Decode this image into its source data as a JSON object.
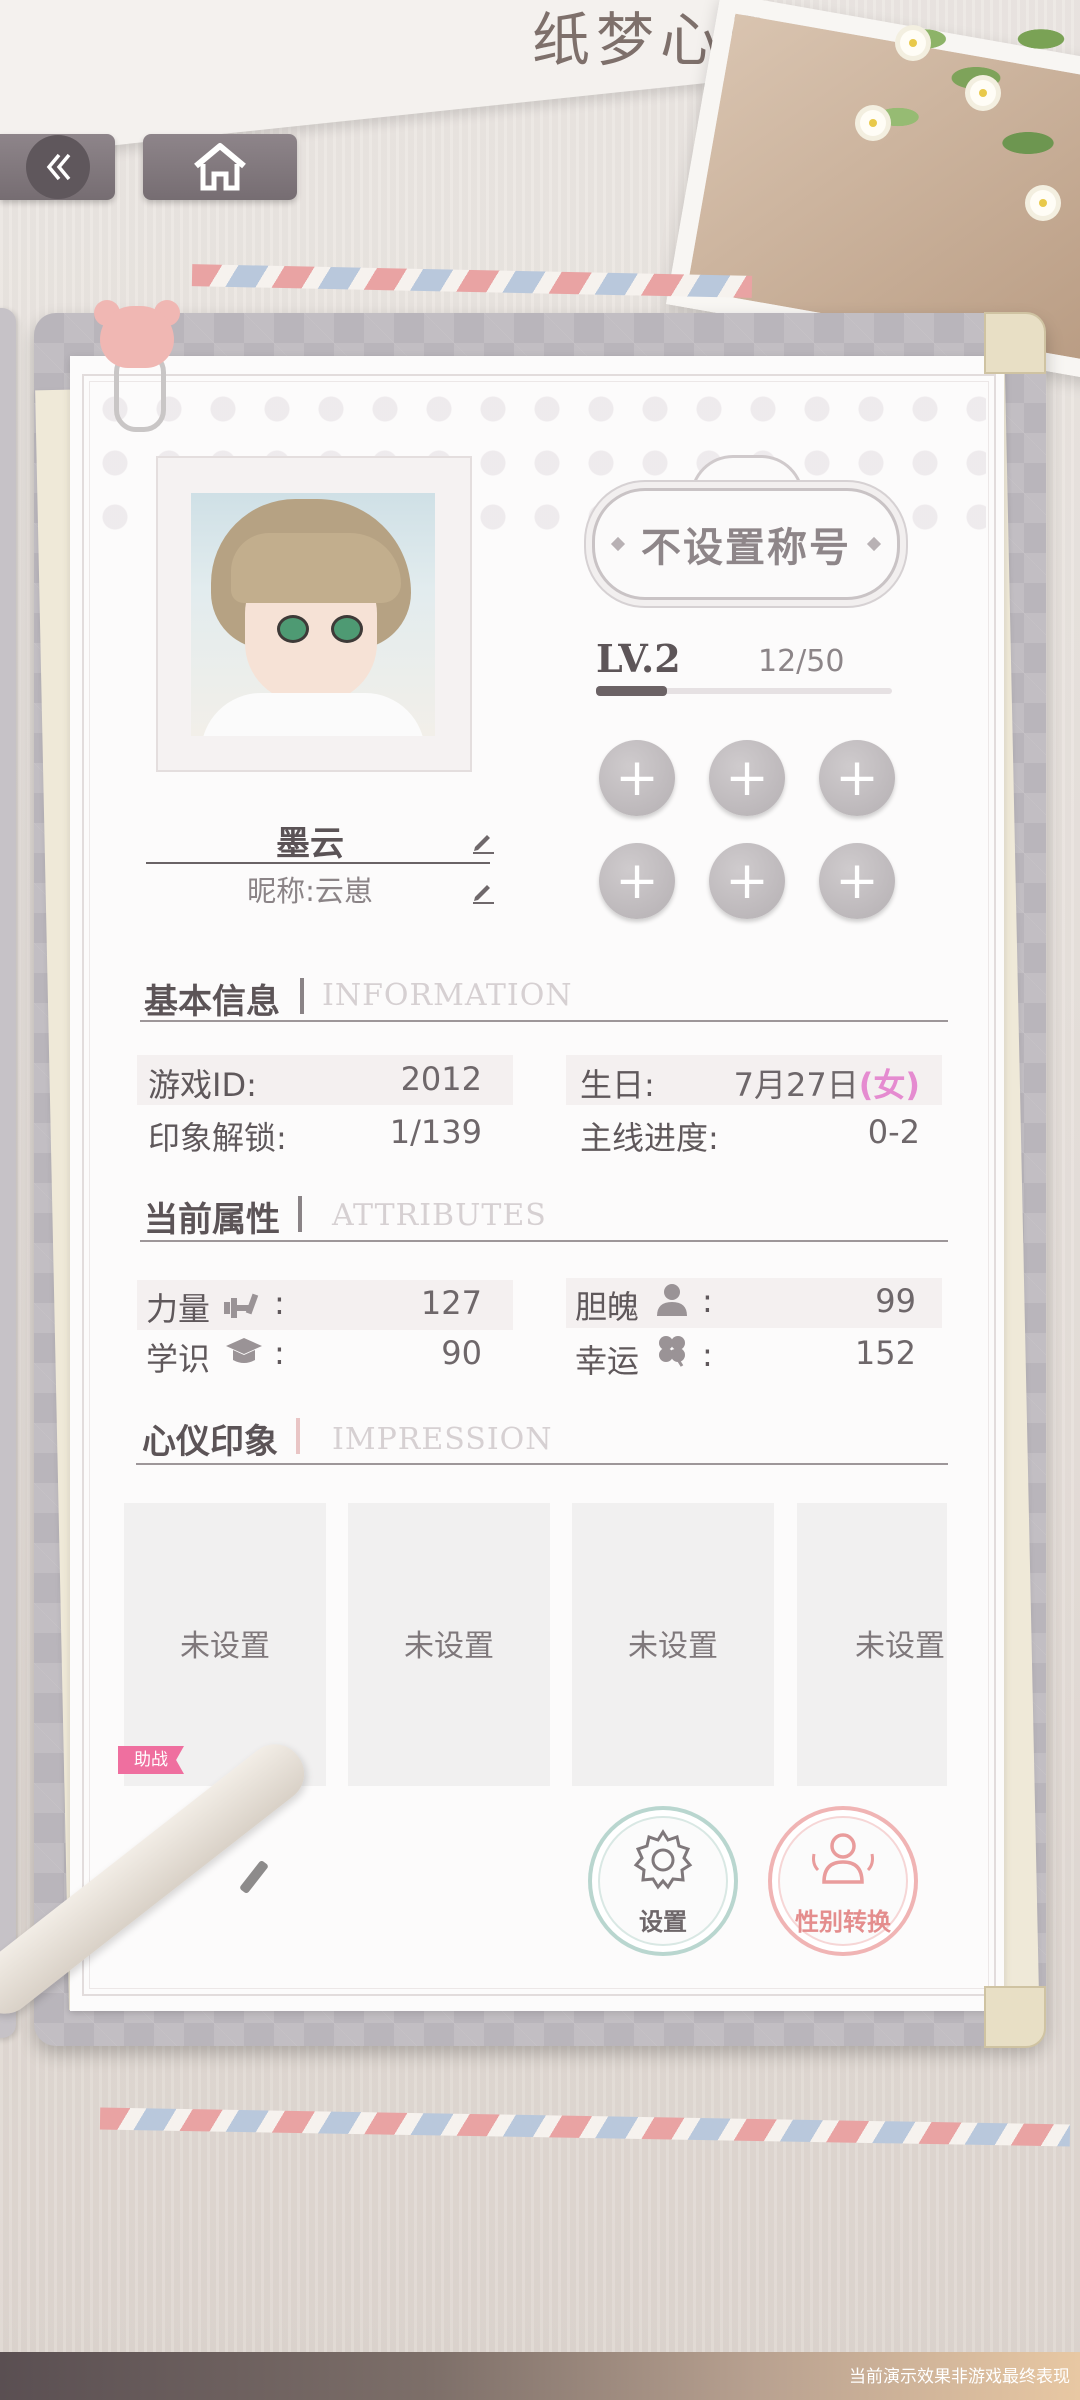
{
  "header": {
    "logo_text": "纸梦心语",
    "back_icon": "double-chevron-left-icon",
    "home_icon": "home-icon"
  },
  "profile": {
    "title_badge": "不设置称号",
    "level_label": "LV.2",
    "exp_text": "12/50",
    "exp_progress": 0.24,
    "name": "墨云",
    "nickname": "昵称:云崽",
    "slots": [
      "+",
      "+",
      "+",
      "+",
      "+",
      "+"
    ]
  },
  "basic_info": {
    "title": "基本信息",
    "title_en": "INFORMATION",
    "game_id_label": "游戏ID:",
    "game_id": "2012",
    "birthday_label": "生日:",
    "birthday": "7月27日",
    "gender": "(女)",
    "impression_label": "印象解锁:",
    "impression": "1/139",
    "progress_label": "主线进度:",
    "progress": "0-2"
  },
  "attributes": {
    "title": "当前属性",
    "title_en": "ATTRIBUTES",
    "items": [
      {
        "label": "力量",
        "icon": "dumbbell-icon",
        "colon": ":",
        "value": "127"
      },
      {
        "label": "胆魄",
        "icon": "person-icon",
        "colon": ":",
        "value": "99"
      },
      {
        "label": "学识",
        "icon": "graduation-cap-icon",
        "colon": ":",
        "value": "90"
      },
      {
        "label": "幸运",
        "icon": "clover-icon",
        "colon": ":",
        "value": "152"
      }
    ]
  },
  "impression": {
    "title": "心仪印象",
    "title_en": "IMPRESSION",
    "slots": [
      "未设置",
      "未设置",
      "未设置",
      "未设置"
    ],
    "assist_tag": "助战"
  },
  "actions": {
    "settings": "设置",
    "gender_switch": "性别转换"
  },
  "footer": {
    "note": "当前演示效果非游戏最终表现"
  },
  "colors": {
    "accent_pink": "#e58bd0",
    "settings_ring": "#b9d6cf",
    "gender_ring": "#f0b4b4",
    "assist_tag": "#ef6f9f"
  }
}
